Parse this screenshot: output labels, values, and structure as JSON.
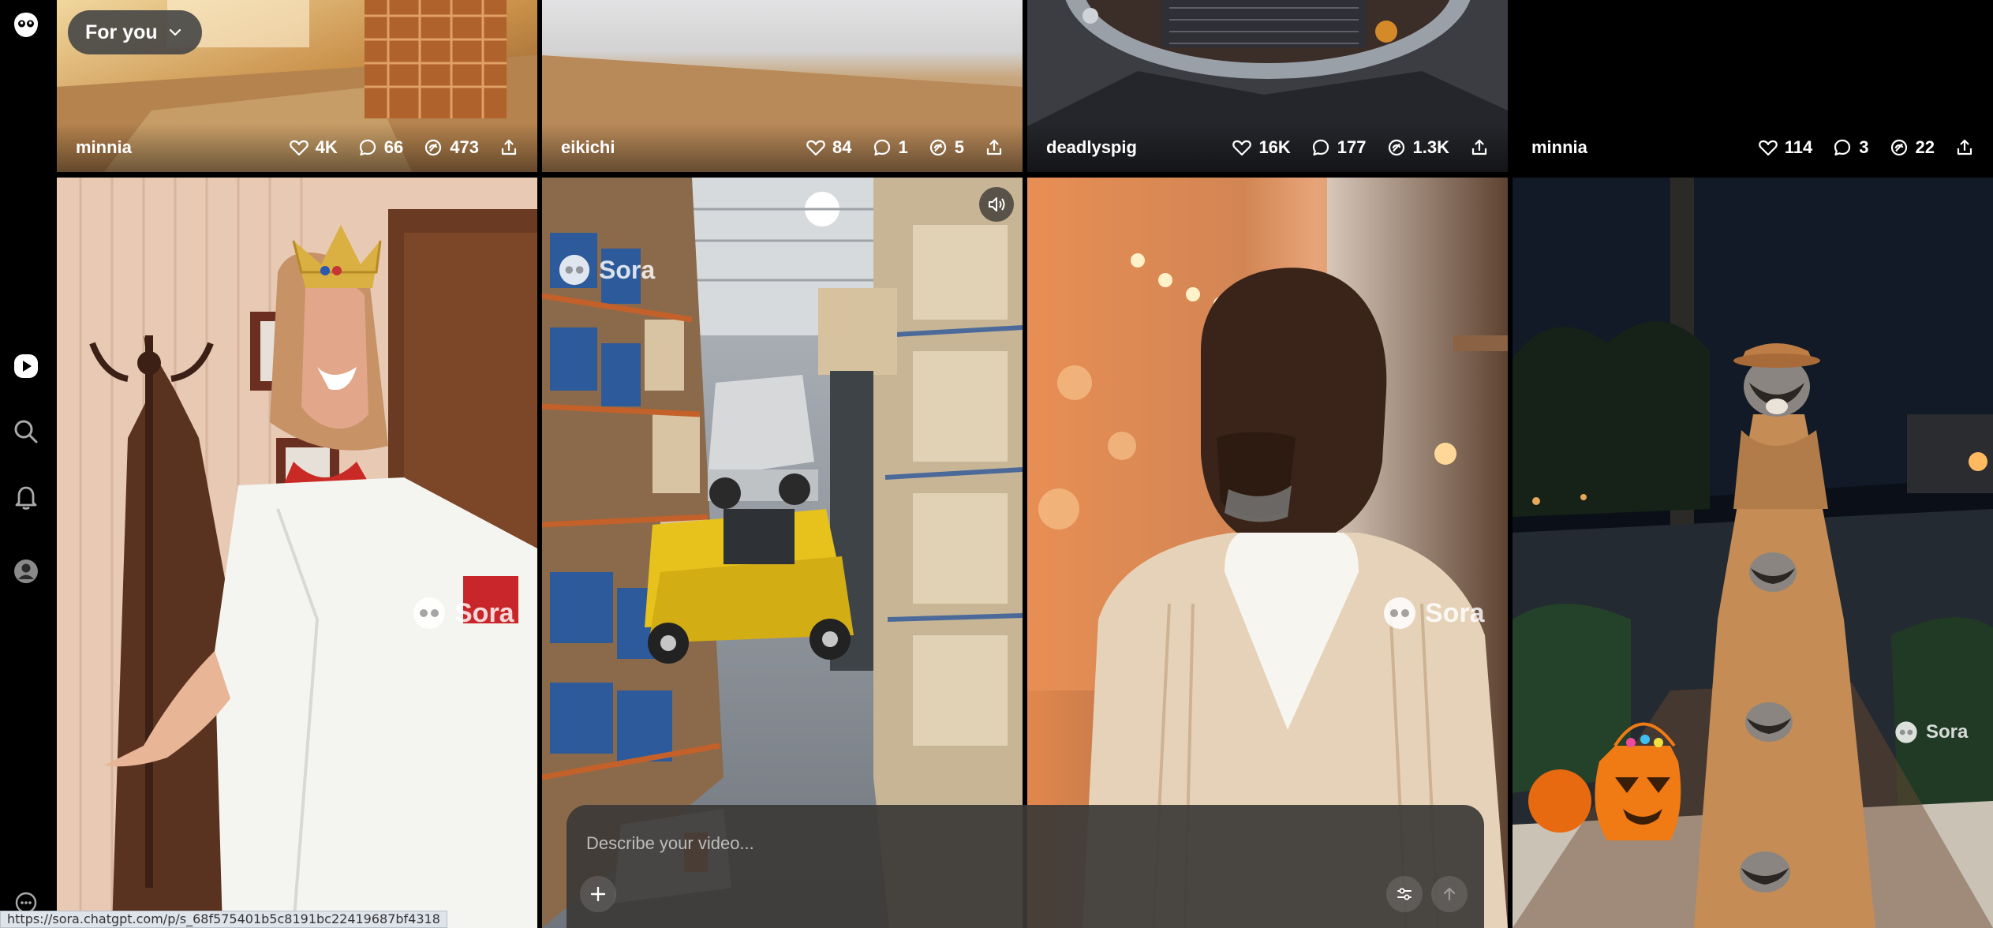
{
  "app": {
    "feed_mode": "For you",
    "status_url": "https://sora.chatgpt.com/p/s_68f575401b5c8191bc22419687bf4318"
  },
  "sidebar": {
    "items": [
      {
        "icon": "sora-logo-icon"
      },
      {
        "icon": "play-icon"
      },
      {
        "icon": "search-icon"
      },
      {
        "icon": "bell-icon"
      },
      {
        "icon": "profile-icon"
      },
      {
        "icon": "more-icon"
      }
    ]
  },
  "top_row": [
    {
      "username": "minnia",
      "likes": "4K",
      "comments": "66",
      "remixes": "473"
    },
    {
      "username": "eikichi",
      "likes": "84",
      "comments": "1",
      "remixes": "5"
    },
    {
      "username": "deadlyspig",
      "likes": "16K",
      "comments": "177",
      "remixes": "1.3K"
    },
    {
      "username": "minnia",
      "likes": "114",
      "comments": "3",
      "remixes": "22"
    }
  ],
  "watermark": "Sora",
  "composer": {
    "placeholder": "Describe your video..."
  },
  "colors": {
    "background": "#000000",
    "forklift_yellow": "#e7c21c",
    "pumpkin_orange": "#f07a13"
  }
}
